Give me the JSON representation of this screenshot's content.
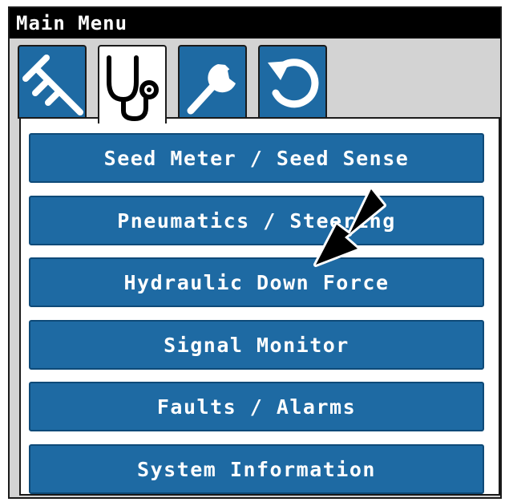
{
  "window": {
    "title": "Main Menu"
  },
  "tabs": [
    {
      "icon": "caliper-icon",
      "active": false
    },
    {
      "icon": "stethoscope-icon",
      "active": true
    },
    {
      "icon": "wrench-icon",
      "active": false
    },
    {
      "icon": "reset-icon",
      "active": false
    }
  ],
  "menu": {
    "items": [
      {
        "label": "Seed Meter / Seed Sense"
      },
      {
        "label": "Pneumatics / Steering"
      },
      {
        "label": "Hydraulic Down Force"
      },
      {
        "label": "Signal Monitor"
      },
      {
        "label": "Faults / Alarms"
      },
      {
        "label": "System Information"
      }
    ]
  },
  "annotation": {
    "pointer": "arrow pointing at Hydraulic Down Force"
  },
  "colors": {
    "accent": "#1e6aa3",
    "titlebar": "#000000",
    "background": "#d3d3d3"
  }
}
